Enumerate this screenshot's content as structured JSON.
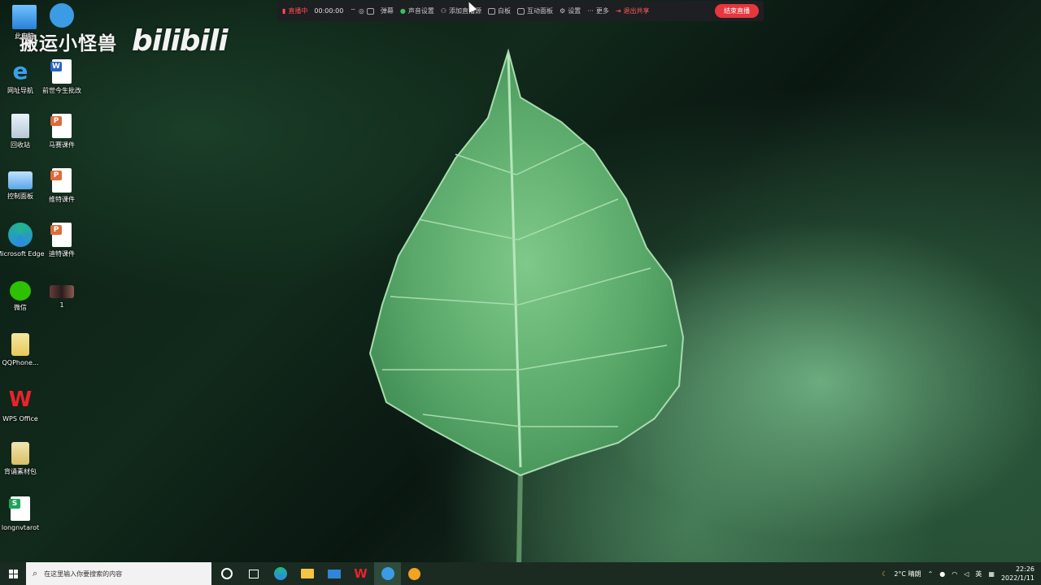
{
  "watermark": {
    "text": "搬运小怪兽",
    "logo": "bilibili"
  },
  "desktop_icons": [
    {
      "label": "此电脑",
      "icon": "this-pc-icon"
    },
    {
      "label": "网址导航",
      "icon": "ie-icon"
    },
    {
      "label": "前世今生批改",
      "icon": "word-doc-icon"
    },
    {
      "label": "回收站",
      "icon": "recycle-bin-icon"
    },
    {
      "label": "马赛课件",
      "icon": "ppt-icon"
    },
    {
      "label": "控制面板",
      "icon": "control-panel-icon"
    },
    {
      "label": "维特课件",
      "icon": "ppt-icon"
    },
    {
      "label": "Microsoft Edge",
      "icon": "edge-icon"
    },
    {
      "label": "迪特课件",
      "icon": "ppt-icon"
    },
    {
      "label": "微信",
      "icon": "wechat-icon"
    },
    {
      "label": "1",
      "icon": "image-icon"
    },
    {
      "label": "QQPhone...",
      "icon": "folder-icon"
    },
    {
      "label": "WPS Office",
      "icon": "wps-icon"
    },
    {
      "label": "背诵素材包",
      "icon": "archive-icon"
    },
    {
      "label": "longnvtarot",
      "icon": "spreadsheet-icon"
    }
  ],
  "toolbar": {
    "live": "直播中",
    "timer": "00:00:00",
    "record": "弹幕",
    "sound": "声音设置",
    "add_stream": "添加直播源",
    "whiteboard": "白板",
    "interactive": "互动面板",
    "settings": "设置",
    "more": "更多",
    "exit_share": "退出共享",
    "end_live": "结束直播"
  },
  "taskbar": {
    "search_placeholder": "在这里输入你要搜索的内容",
    "weather_temp": "2°C",
    "weather_desc": "晴朗",
    "ime": "英",
    "time": "22:26",
    "date": "2022/1/11"
  },
  "colors": {
    "toolbar_bg": "#1e1f22",
    "end_button": "#e5373c",
    "taskbar_bg": "#1b2b22"
  }
}
